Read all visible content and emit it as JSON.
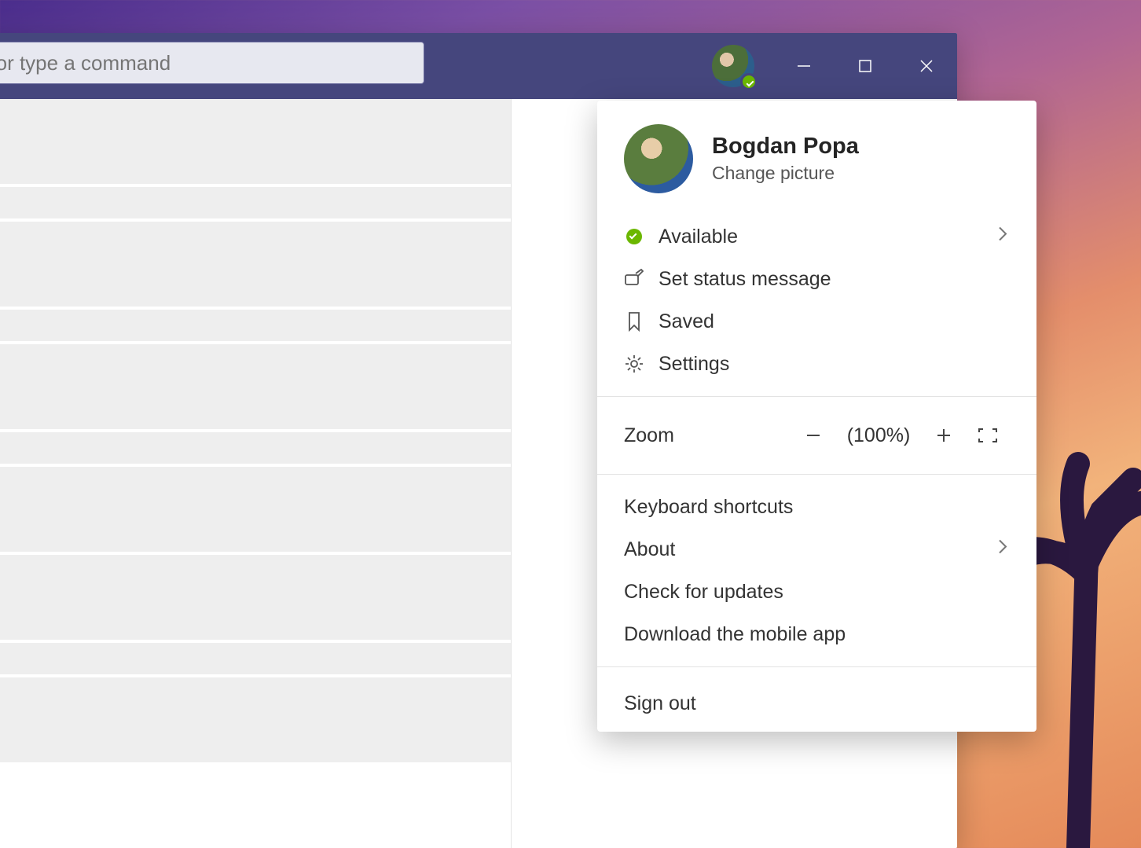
{
  "search": {
    "placeholder": "Search or type a command"
  },
  "titlebar": {
    "presence_status": "available"
  },
  "profile": {
    "name": "Bogdan Popa",
    "change_picture": "Change picture"
  },
  "menu": {
    "status_label": "Available",
    "set_status": "Set status message",
    "saved": "Saved",
    "settings": "Settings",
    "zoom_label": "Zoom",
    "zoom_value": "(100%)",
    "keyboard": "Keyboard shortcuts",
    "about": "About",
    "updates": "Check for updates",
    "download": "Download the mobile app",
    "signout": "Sign out"
  }
}
